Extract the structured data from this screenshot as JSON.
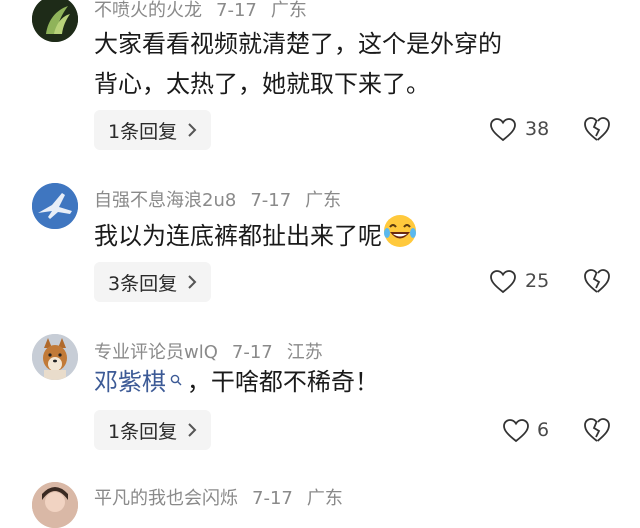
{
  "comments": [
    {
      "username": "不喷火的火龙",
      "date": "7-17",
      "location": "广东",
      "text": "大家看看视频就清楚了，这个是外穿的背心，太热了，她就取下来了。",
      "reply_label": "1条回复",
      "likes": "38"
    },
    {
      "username": "自强不息海浪2u8",
      "date": "7-17",
      "location": "广东",
      "text": "我以为连底裤都扯出来了呢",
      "reply_label": "3条回复",
      "likes": "25"
    },
    {
      "username": "专业评论员wlQ",
      "date": "7-17",
      "location": "江苏",
      "mention": "邓紫棋",
      "text_after_mention": "，干啥都不稀奇！",
      "reply_label": "1条回复",
      "likes": "6"
    },
    {
      "username": "平凡的我也会闪烁",
      "date": "7-17",
      "location": "广东"
    }
  ]
}
